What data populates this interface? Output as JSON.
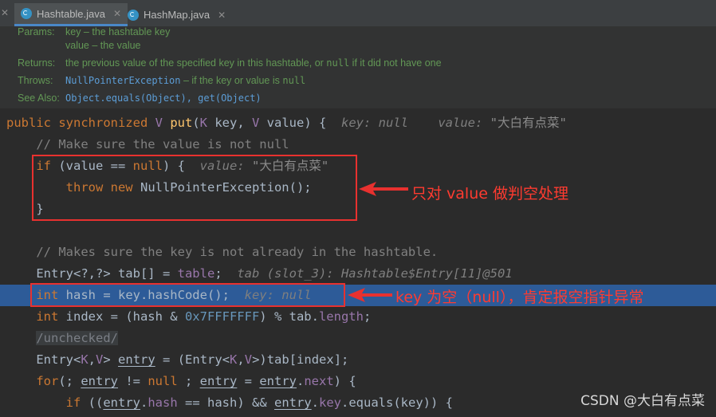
{
  "tabs": [
    {
      "label": "Hashtable.java",
      "active": true
    },
    {
      "label": "HashMap.java",
      "active": false
    }
  ],
  "javadoc": {
    "params_label": "Params:",
    "param_key": "key – the hashtable key",
    "param_value": "value – the value",
    "returns_label": "Returns:",
    "returns_pre": "the previous value of the specified key in this hashtable, or ",
    "returns_null": "null",
    "returns_post": " if it did not have one",
    "throws_label": "Throws:",
    "throws_link": "NullPointerException",
    "throws_mid": " – if the key or value is ",
    "throws_null": "null",
    "see_label": "See Also:",
    "see_link1": "Object.equals(Object)",
    "see_sep": ", ",
    "see_link2": "get(Object)"
  },
  "code": {
    "l1": {
      "kw1": "public synchronized ",
      "type": "V ",
      "fn": "put",
      "p1": "(",
      "t1": "K",
      "p2": " key, ",
      "t2": "V",
      "p3": " value) {",
      "hint1": "key: null",
      "hint2_label": "value: ",
      "hint2_val": "\"大白有点菜\""
    },
    "l2": {
      "comment": "// Make sure the value is not null"
    },
    "l3": {
      "kw": "if",
      "p1": " (value == ",
      "kw2": "null",
      "p2": ") {",
      "hint_label": "value: ",
      "hint_val": "\"大白有点菜\""
    },
    "l4": {
      "kw1": "throw new ",
      "cls": "NullPointerException",
      "p": "();"
    },
    "l5": {
      "p": "}"
    },
    "l6": {
      "comment": "// Makes sure the key is not already in the hashtable."
    },
    "l7": {
      "p1": "Entry<?,?> tab[] = ",
      "field": "table",
      "p2": ";",
      "hint": "tab (slot_3): Hashtable$Entry[11]@501"
    },
    "l8": {
      "kw": "int",
      "p1": " hash = key.hashCode();",
      "hint": "key: null"
    },
    "l9": {
      "kw": "int",
      "p1": " index = (hash & ",
      "num": "0x7FFFFFFF",
      "p2": ") % tab.",
      "field": "length",
      "p3": ";"
    },
    "l10": {
      "anno": "/unchecked/"
    },
    "l11": {
      "p1": "Entry<",
      "t1": "K",
      "p2": ",",
      "t2": "V",
      "p3": "> ",
      "var": "entry",
      "p4": " = (Entry<",
      "t3": "K",
      "p5": ",",
      "t4": "V",
      "p6": ">)tab[index];"
    },
    "l12": {
      "kw": "for",
      "p1": "(; ",
      "var1": "entry",
      "p2": " != ",
      "kw2": "null",
      "p3": " ; ",
      "var2": "entry",
      "p4": " = ",
      "var3": "entry",
      "p5": ".",
      "field": "next",
      "p6": ") {"
    },
    "l13": {
      "kw": "if",
      "p1": " ((",
      "var1": "entry",
      "p2": ".",
      "f1": "hash",
      "p3": " == hash) && ",
      "var2": "entry",
      "p4": ".",
      "f2": "key",
      "p5": ".equals(key)) {"
    }
  },
  "annotations": {
    "a1": "只对 value 做判空处理",
    "a2": "key 为空（null），肯定报空指针异常"
  },
  "watermark": "CSDN @大白有点菜",
  "colors": {
    "annotation_red": "#e8312f",
    "highlight": "#2d5b98"
  }
}
